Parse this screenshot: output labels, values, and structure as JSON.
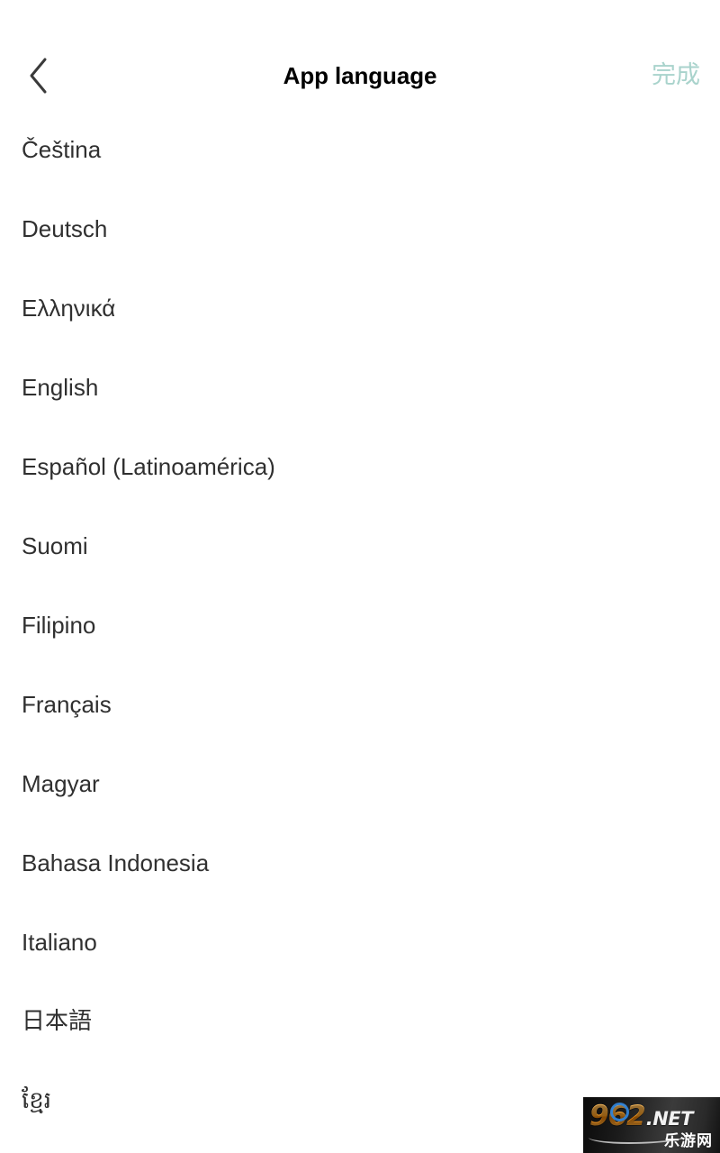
{
  "app_bar": {
    "back_icon": "chevron-left-icon",
    "title": "App language",
    "done_label": "完成",
    "done_color": "#a9d3cc",
    "title_color": "#000000"
  },
  "language_list": {
    "item_text_color": "#303030",
    "items": [
      {
        "label": "Čeština",
        "script": "latin"
      },
      {
        "label": "Deutsch",
        "script": "latin"
      },
      {
        "label": "Ελληνικά",
        "script": "greek"
      },
      {
        "label": "English",
        "script": "latin"
      },
      {
        "label": "Español (Latinoamérica)",
        "script": "latin"
      },
      {
        "label": "Suomi",
        "script": "latin"
      },
      {
        "label": "Filipino",
        "script": "latin"
      },
      {
        "label": "Français",
        "script": "latin"
      },
      {
        "label": "Magyar",
        "script": "latin"
      },
      {
        "label": "Bahasa Indonesia",
        "script": "latin"
      },
      {
        "label": "Italiano",
        "script": "latin"
      },
      {
        "label": "日本語",
        "script": "cjk"
      },
      {
        "label": "ខ្មែរ",
        "script": "khmer"
      }
    ]
  },
  "watermark": {
    "brand_number": "962",
    "brand_tld": ".NET",
    "brand_cn": "乐游网",
    "number_color": "#f79a1e",
    "ring_color": "#2f83d8",
    "tld_color": "#f2f2f2"
  }
}
